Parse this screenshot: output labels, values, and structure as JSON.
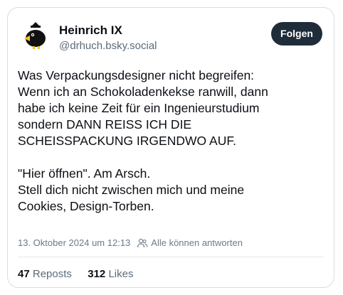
{
  "author": {
    "display_name": "Heinrich IX",
    "handle": "@drhuch.bsky.social",
    "avatar_icon": "penguin-bird-avatar-icon"
  },
  "follow_button": {
    "label": "Folgen"
  },
  "post": {
    "paragraph_1": [
      "Was Verpackungsdesigner nicht begreifen:",
      "Wenn ich an Schokoladenkekse ranwill, dann",
      "habe ich keine Zeit für ein Ingenieurstudium",
      "sondern DANN REISS ICH DIE",
      "SCHEISSPACKUNG IRGENDWO AUF."
    ],
    "paragraph_2": [
      "\"Hier öffnen\". Am Arsch.",
      "Stell dich nicht zwischen mich und meine",
      "Cookies, Design-Torben."
    ]
  },
  "meta": {
    "timestamp": "13. Oktober 2024 um 12:13",
    "reply_icon": "people-icon",
    "reply_setting": "Alle können antworten"
  },
  "stats": {
    "reposts_count": "47",
    "reposts_label": "Reposts",
    "likes_count": "312",
    "likes_label": "Likes"
  },
  "colors": {
    "follow_button_bg": "#1f2d3a",
    "secondary_text": "#5b6b7a",
    "border": "#d8dde2"
  }
}
